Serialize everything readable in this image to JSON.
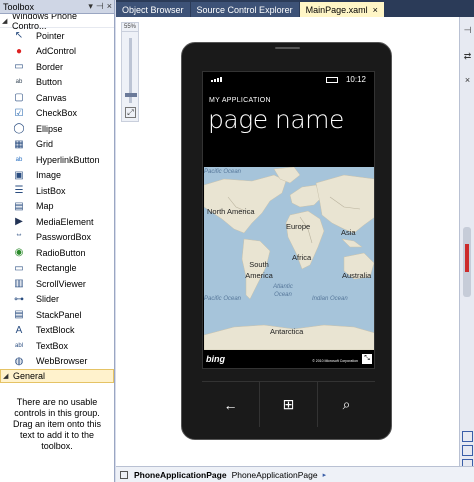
{
  "toolbox": {
    "title": "Toolbox",
    "header_buttons": [
      "▾",
      "⊣",
      "×"
    ],
    "group_title": "Windows Phone Contro...",
    "items": [
      {
        "label": "Pointer",
        "icon": "pointer-icon"
      },
      {
        "label": "AdControl",
        "icon": "adcontrol-icon"
      },
      {
        "label": "Border",
        "icon": "border-icon"
      },
      {
        "label": "Button",
        "icon": "button-icon"
      },
      {
        "label": "Canvas",
        "icon": "canvas-icon"
      },
      {
        "label": "CheckBox",
        "icon": "checkbox-icon"
      },
      {
        "label": "Ellipse",
        "icon": "ellipse-icon"
      },
      {
        "label": "Grid",
        "icon": "grid-icon"
      },
      {
        "label": "HyperlinkButton",
        "icon": "hyperlink-icon"
      },
      {
        "label": "Image",
        "icon": "image-icon"
      },
      {
        "label": "ListBox",
        "icon": "listbox-icon"
      },
      {
        "label": "Map",
        "icon": "map-icon"
      },
      {
        "label": "MediaElement",
        "icon": "media-icon"
      },
      {
        "label": "PasswordBox",
        "icon": "password-icon"
      },
      {
        "label": "RadioButton",
        "icon": "radio-icon"
      },
      {
        "label": "Rectangle",
        "icon": "rectangle-icon"
      },
      {
        "label": "ScrollViewer",
        "icon": "scrollviewer-icon"
      },
      {
        "label": "Slider",
        "icon": "slider-icon"
      },
      {
        "label": "StackPanel",
        "icon": "stackpanel-icon"
      },
      {
        "label": "TextBlock",
        "icon": "textblock-icon"
      },
      {
        "label": "TextBox",
        "icon": "textbox-icon"
      },
      {
        "label": "WebBrowser",
        "icon": "webbrowser-icon"
      }
    ],
    "general_title": "General",
    "general_text": "There are no usable controls in this group. Drag an item onto this text to add it to the toolbox."
  },
  "tabs": [
    {
      "label": "Object Browser",
      "active": false
    },
    {
      "label": "Source Control Explorer",
      "active": false
    },
    {
      "label": "MainPage.xaml",
      "active": true
    }
  ],
  "tab_close": "×",
  "zoom": {
    "label": "55%",
    "fit": "⤢"
  },
  "phone": {
    "time": "10:12",
    "app_title": "MY APPLICATION",
    "page_title": "page name",
    "map": {
      "labels": {
        "pacific_top": "Pacific Ocean",
        "north_america": "North America",
        "europe": "Europe",
        "asia": "Asia",
        "africa": "Africa",
        "south_america": "South America",
        "atlantic": "Atlantic Ocean",
        "australia": "Australia",
        "pacific_bottom": "Pacific Ocean",
        "indian": "Indian Ocean",
        "antarctica": "Antarctica"
      },
      "logo": "bing",
      "copyright": "© 2010 Microsoft Corporation"
    },
    "nav": {
      "back": "←",
      "start": "⊞",
      "search": "⌕"
    }
  },
  "bottombar": {
    "crumb_active": "PhoneApplicationPage",
    "crumb_next": "PhoneApplicationPage",
    "arrow": "▸"
  },
  "rightbar": {
    "pin": "⊣",
    "swap": "⇄",
    "close": "×"
  },
  "colors": {
    "accent": "#2b3b58",
    "active_tab": "#fff6c7",
    "map_water": "#a6c4da",
    "map_land": "#e9e4d2"
  }
}
